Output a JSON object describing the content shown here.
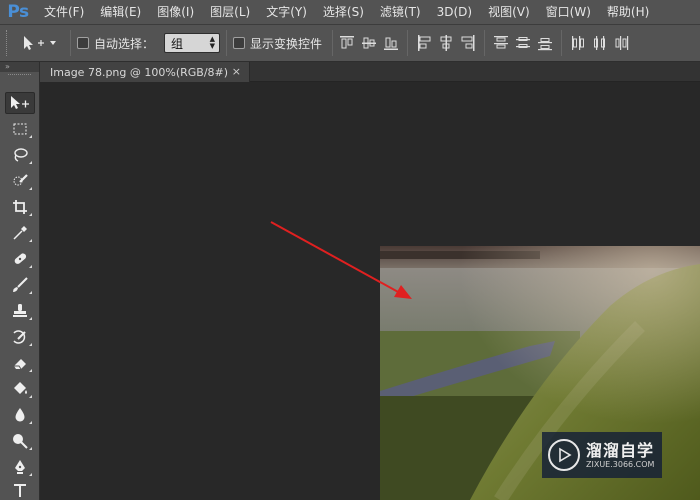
{
  "app": {
    "logo": "Ps"
  },
  "menu": [
    "文件(F)",
    "编辑(E)",
    "图像(I)",
    "图层(L)",
    "文字(Y)",
    "选择(S)",
    "滤镜(T)",
    "3D(D)",
    "视图(V)",
    "窗口(W)",
    "帮助(H)"
  ],
  "options": {
    "auto_select_label": "自动选择：",
    "auto_select_checked": false,
    "auto_select_target": "组",
    "show_transform_label": "显示变换控件",
    "show_transform_checked": false
  },
  "document_tab": {
    "title": "Image 78.png @ 100%(RGB/8#)",
    "close": "×"
  },
  "tools_panel": {
    "collapse": "»"
  },
  "tools": [
    "move-tool-icon",
    "marquee-tool-icon",
    "lasso-tool-icon",
    "quick-select-tool-icon",
    "crop-tool-icon",
    "eyedropper-tool-icon",
    "healing-brush-tool-icon",
    "brush-tool-icon",
    "clone-stamp-tool-icon",
    "history-brush-tool-icon",
    "eraser-tool-icon",
    "paint-bucket-tool-icon",
    "blur-tool-icon",
    "dodge-tool-icon",
    "pen-tool-icon",
    "type-tool-icon"
  ],
  "watermark": {
    "title": "溜溜自学",
    "url": "ZIXUE.3066.COM"
  },
  "colors": {
    "ui_bg": "#535353",
    "canvas_bg": "#282828",
    "arrow": "#e02020",
    "ps_blue": "#4a8fd6"
  }
}
